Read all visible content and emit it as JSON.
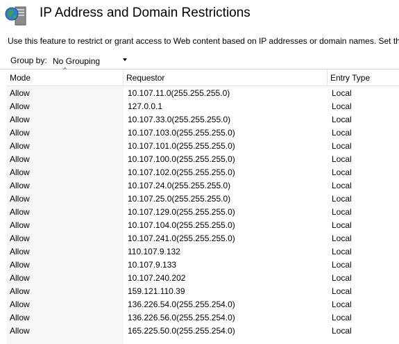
{
  "page": {
    "title": "IP Address and Domain Restrictions",
    "description": "Use this feature to restrict or grant access to Web content based on IP addresses or domain names. Set the r"
  },
  "toolbar": {
    "group_by_label": "Group by:",
    "group_by_value": "No Grouping"
  },
  "table": {
    "columns": [
      "Mode",
      "Requestor",
      "Entry Type"
    ],
    "rows": [
      {
        "mode": "Allow",
        "requestor": "10.107.11.0(255.255.255.0)",
        "entry_type": "Local"
      },
      {
        "mode": "Allow",
        "requestor": "127.0.0.1",
        "entry_type": "Local"
      },
      {
        "mode": "Allow",
        "requestor": "10.107.33.0(255.255.255.0)",
        "entry_type": "Local"
      },
      {
        "mode": "Allow",
        "requestor": "10.107.103.0(255.255.255.0)",
        "entry_type": "Local"
      },
      {
        "mode": "Allow",
        "requestor": "10.107.101.0(255.255.255.0)",
        "entry_type": "Local"
      },
      {
        "mode": "Allow",
        "requestor": "10.107.100.0(255.255.255.0)",
        "entry_type": "Local"
      },
      {
        "mode": "Allow",
        "requestor": "10.107.102.0(255.255.255.0)",
        "entry_type": "Local"
      },
      {
        "mode": "Allow",
        "requestor": "10.107.24.0(255.255.255.0)",
        "entry_type": "Local"
      },
      {
        "mode": "Allow",
        "requestor": "10.107.25.0(255.255.255.0)",
        "entry_type": "Local"
      },
      {
        "mode": "Allow",
        "requestor": "10.107.129.0(255.255.255.0)",
        "entry_type": "Local"
      },
      {
        "mode": "Allow",
        "requestor": "10.107.104.0(255.255.255.0)",
        "entry_type": "Local"
      },
      {
        "mode": "Allow",
        "requestor": "10.107.241.0(255.255.255.0)",
        "entry_type": "Local"
      },
      {
        "mode": "Allow",
        "requestor": "110.107.9.132",
        "entry_type": "Local"
      },
      {
        "mode": "Allow",
        "requestor": "10.107.9.133",
        "entry_type": "Local"
      },
      {
        "mode": "Allow",
        "requestor": "10.107.240.202",
        "entry_type": "Local"
      },
      {
        "mode": "Allow",
        "requestor": "159.121.110.39",
        "entry_type": "Local"
      },
      {
        "mode": "Allow",
        "requestor": "136.226.54.0(255.255.254.0)",
        "entry_type": "Local"
      },
      {
        "mode": "Allow",
        "requestor": "136.226.56.0(255.255.254.0)",
        "entry_type": "Local"
      },
      {
        "mode": "Allow",
        "requestor": "165.225.50.0(255.255.254.0)",
        "entry_type": "Local"
      }
    ]
  }
}
